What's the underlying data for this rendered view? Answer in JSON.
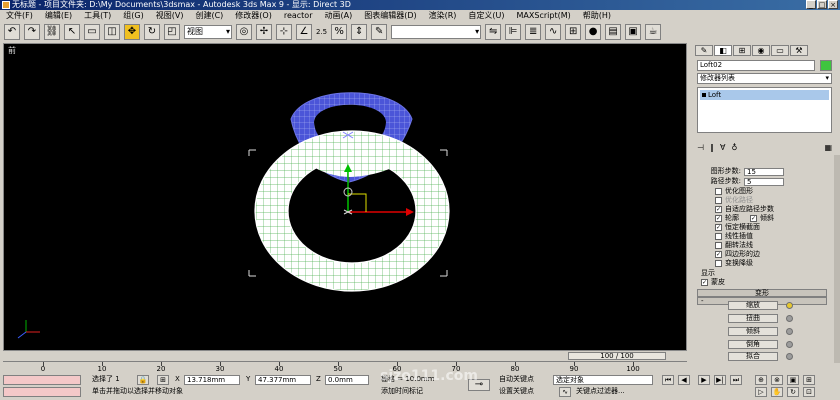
{
  "title": "无标题 - 项目文件夹: D:\\My Documents\\3dsmax - Autodesk 3ds Max 9 - 显示: Direct 3D",
  "menu": [
    "文件(F)",
    "编辑(E)",
    "工具(T)",
    "组(G)",
    "视图(V)",
    "创建(C)",
    "修改器(O)",
    "reactor",
    "动画(A)",
    "图表编辑器(D)",
    "渲染(R)",
    "自定义(U)",
    "MAXScript(M)",
    "帮助(H)"
  ],
  "toolbar": {
    "ref_coord": "视图",
    "snap_value": "2.5",
    "named_selection": ""
  },
  "viewport": {
    "label": "前"
  },
  "command_panel": {
    "object_name": "Loft02",
    "modifier_list": "修改器列表",
    "stack_item": "Loft",
    "skin_params": {
      "shape_steps_label": "图形步数:",
      "shape_steps": "15",
      "path_steps_label": "路径步数:",
      "path_steps": "5",
      "optimize_shapes": "优化图形",
      "optimize_path": "优化路径",
      "adaptive_path": "自适应路径步数",
      "contour": "轮廓",
      "banking": "倾斜",
      "constant_cross": "恒定横截面",
      "linear_interp": "线性插值",
      "flip_normals": "翻转法线",
      "quad_sides": "四边形的边",
      "transform_degrade": "变换降级"
    },
    "display_label": "显示",
    "skin_label": "蒙皮",
    "deform_label": "变形",
    "deform_buttons": [
      "缩放",
      "扭曲",
      "倾斜",
      "倒角",
      "拟合"
    ]
  },
  "timeline": {
    "frame_display": "100 / 100",
    "ticks": [
      "0",
      "10",
      "20",
      "30",
      "40",
      "50",
      "60",
      "70",
      "80",
      "90",
      "100"
    ]
  },
  "status": {
    "selected_label": "选择了 1",
    "x_value": "13.718mm",
    "y_value": "47.377mm",
    "z_value": "0.0mm",
    "grid_label": "栅格 = 10.0mm",
    "prompt": "单击并拖动以选择并移动对象",
    "add_time_tag": "添加时间标记",
    "auto_key": "自动关键点",
    "set_key": "设置关键点",
    "selected_object": "选定对象",
    "key_filters": "关键点过滤器..."
  },
  "watermark": "sjzo111.com"
}
